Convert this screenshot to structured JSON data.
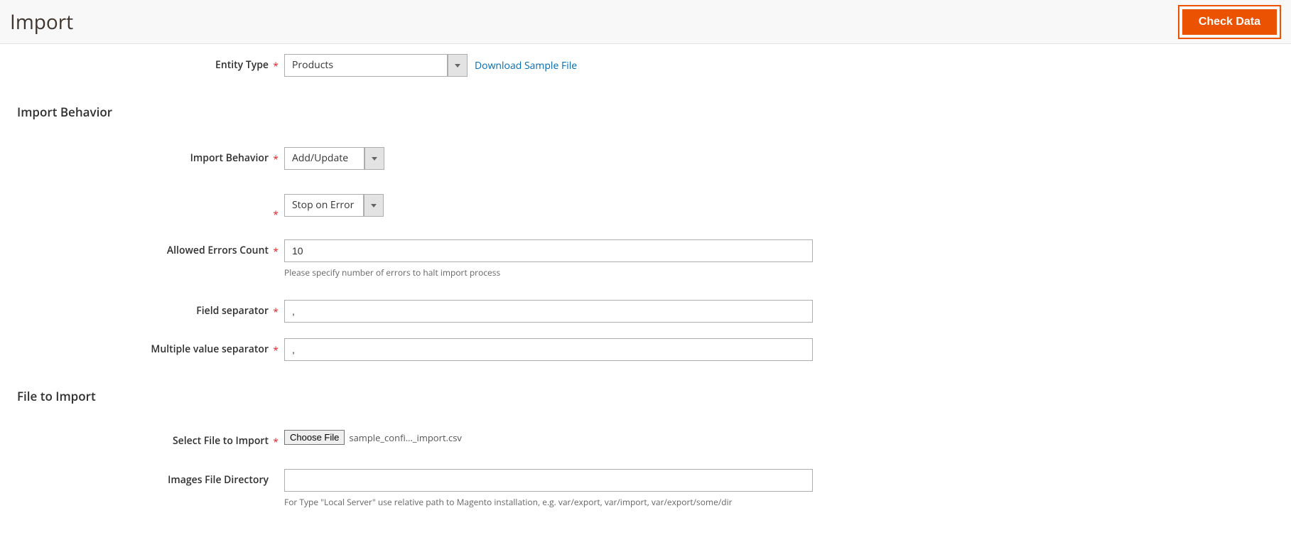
{
  "header": {
    "title": "Import",
    "check_data_label": "Check Data"
  },
  "entity_type": {
    "label": "Entity Type",
    "value": "Products",
    "download_link": "Download Sample File"
  },
  "section_behavior_title": "Import Behavior",
  "import_behavior": {
    "label": "Import Behavior",
    "value": "Add/Update"
  },
  "validation_strategy": {
    "value": "Stop on Error"
  },
  "allowed_errors": {
    "label": "Allowed Errors Count",
    "value": "10",
    "helper": "Please specify number of errors to halt import process"
  },
  "field_separator": {
    "label": "Field separator",
    "value": ","
  },
  "multiple_value_separator": {
    "label": "Multiple value separator",
    "value": ","
  },
  "section_file_title": "File to Import",
  "select_file": {
    "label": "Select File to Import",
    "button": "Choose File",
    "filename": "sample_confi…_import.csv"
  },
  "images_dir": {
    "label": "Images File Directory",
    "value": "",
    "helper": "For Type \"Local Server\" use relative path to Magento installation, e.g. var/export, var/import, var/export/some/dir"
  }
}
